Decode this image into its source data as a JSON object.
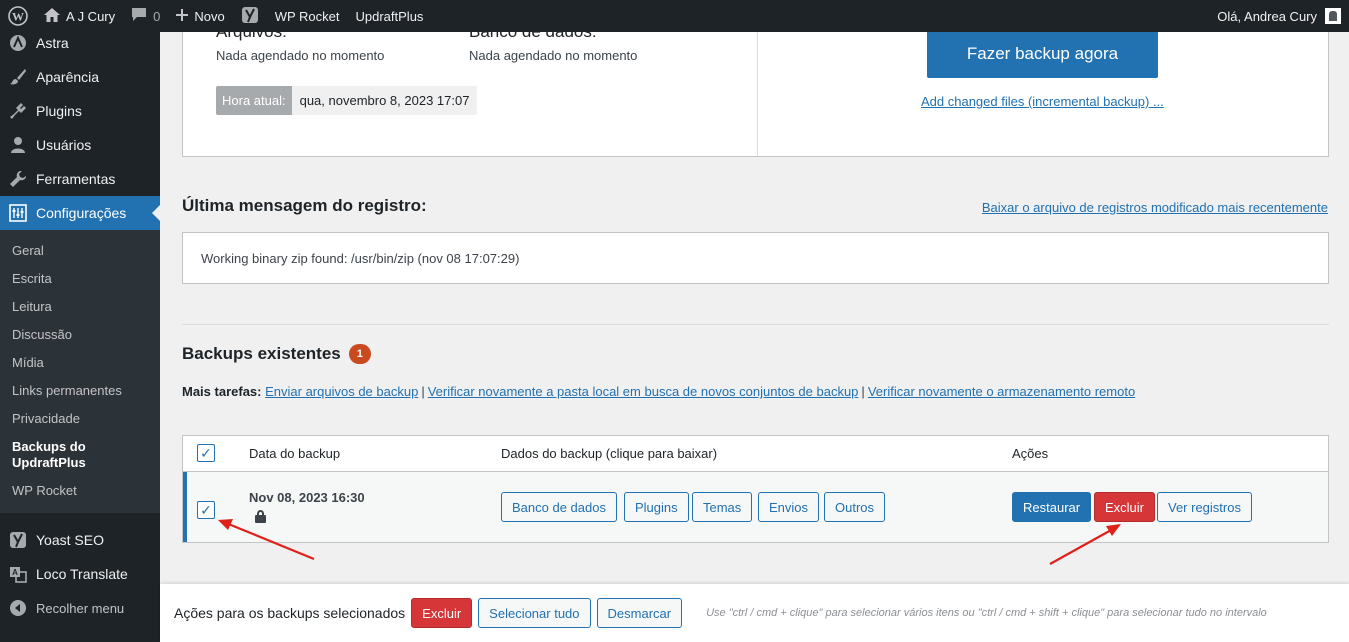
{
  "admin_bar": {
    "site_name": "A J Cury",
    "comments_count": "0",
    "new_label": "Novo",
    "items": [
      "WP Rocket",
      "UpdraftPlus"
    ],
    "greeting": "Olá, Andrea Cury"
  },
  "sidebar": {
    "top_items": [
      {
        "label": "Astra",
        "icon": "astra-icon"
      },
      {
        "label": "Aparência",
        "icon": "paintbrush-icon"
      },
      {
        "label": "Plugins",
        "icon": "plugin-icon"
      },
      {
        "label": "Usuários",
        "icon": "users-icon"
      },
      {
        "label": "Ferramentas",
        "icon": "wrench-icon"
      },
      {
        "label": "Configurações",
        "icon": "settings-icon"
      }
    ],
    "submenu": [
      "Geral",
      "Escrita",
      "Leitura",
      "Discussão",
      "Mídia",
      "Links permanentes",
      "Privacidade",
      "Backups do UpdraftPlus",
      "WP Rocket"
    ],
    "bottom_items": [
      {
        "label": "Yoast SEO",
        "icon": "yoast-icon"
      },
      {
        "label": "Loco Translate",
        "icon": "translate-icon"
      },
      {
        "label": "Recolher menu",
        "icon": "collapse-icon"
      }
    ]
  },
  "status": {
    "files_heading": "Arquivos:",
    "database_heading": "Banco de dados:",
    "files_schedule": "Nada agendado no momento",
    "database_schedule": "Nada agendado no momento",
    "time_label": "Hora atual:",
    "time_value": "qua, novembro 8, 2023 17:07",
    "backup_now": "Fazer backup agora",
    "incremental_link": "Add changed files (incremental backup) ..."
  },
  "log": {
    "title": "Última mensagem do registro:",
    "download_link": "Baixar o arquivo de registros modificado mais recentemente",
    "message": "Working binary zip found: /usr/bin/zip (nov 08 17:07:29)"
  },
  "existing": {
    "title": "Backups existentes",
    "count": "1",
    "more_tasks_label": "Mais tarefas:",
    "tasks": [
      "Enviar arquivos de backup",
      "Verificar novamente a pasta local em busca de novos conjuntos de backup",
      "Verificar novamente o armazenamento remoto"
    ]
  },
  "table": {
    "headers": {
      "date": "Data do backup",
      "data": "Dados do backup (clique para baixar)",
      "actions": "Ações"
    },
    "row": {
      "date": "Nov 08, 2023 16:30",
      "data_buttons": [
        "Banco de dados",
        "Plugins",
        "Temas",
        "Envios",
        "Outros"
      ],
      "actions": {
        "restore": "Restaurar",
        "delete": "Excluir",
        "view_logs": "Ver registros"
      }
    }
  },
  "bottom_bar": {
    "label": "Ações para os backups selecionados",
    "delete": "Excluir",
    "select_all": "Selecionar tudo",
    "deselect": "Desmarcar",
    "hint": "Use \"ctrl / cmd + clique\" para selecionar vários itens ou \"ctrl / cmd + shift + clique\" para selecionar tudo no intervalo"
  },
  "colors": {
    "admin_bg": "#1d2327",
    "accent": "#2271b1",
    "danger": "#d63638",
    "annotation": "#e0201a"
  }
}
